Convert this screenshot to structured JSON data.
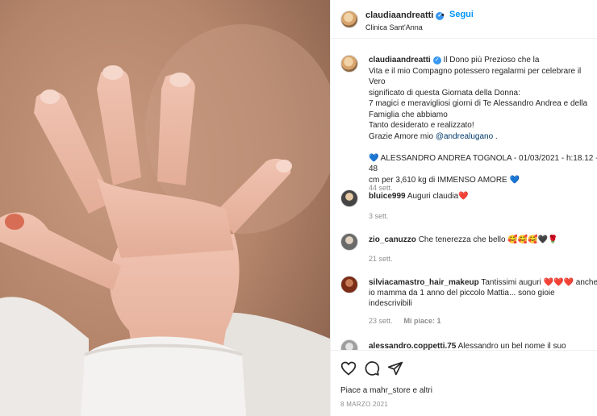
{
  "header": {
    "username": "claudiaandreatti",
    "verified_glyph": "✓",
    "separator": "•",
    "follow_label": "Segui",
    "location": "Clinica Sant'Anna"
  },
  "caption": {
    "username": "claudiaandreatti",
    "verified_glyph": "✓",
    "line1": "Il Dono più Prezioso che la",
    "line2": "Vita e il mio Compagno potessero regalarmi per celebrare il Vero",
    "line3": "significato di questa Giornata della Donna:",
    "line4": "7 magici e meravigliosi giorni di Te Alessandro Andrea e della",
    "line5": "Famiglia che abbiamo",
    "line6": "Tanto desiderato e realizzato!",
    "thanks": "Grazie Amore mio",
    "mention": "@andrealugano",
    "thanks_end": " .",
    "heart_icon": "💙",
    "birth_line1": " ALESSANDRO ANDREA TOGNOLA - 01/03/2021 - h:18.12 - 48",
    "birth_line2": "cm per 3,610 kg di IMMENSO AMORE ",
    "time": "44 sett."
  },
  "comments": [
    {
      "username": "bluice999",
      "text": "Auguri claudia",
      "emoji": "❤️",
      "time": "3 sett.",
      "reply_likes": ""
    },
    {
      "username": "zio_canuzzo",
      "text": "Che tenerezza che bello ",
      "emoji": "🥰🥰🥰🖤🌹",
      "time": "21 sett.",
      "reply_likes": ""
    },
    {
      "username": "silviacamastro_hair_makeup",
      "text": "Tantissimi auguri ",
      "emoji": "❤️❤️❤️",
      "text2": " anche io mamma da 1 anno del piccolo Mattia... sono gioie indescrivibili",
      "time": "23 sett.",
      "reply_likes": "Mi piace: 1"
    },
    {
      "username": "alessandro.coppetti.75",
      "text": "Alessandro un bel nome il suo",
      "emoji": "",
      "time": "",
      "reply_likes": ""
    }
  ],
  "actions": {
    "like_icon": "heart-icon",
    "comment_icon": "comment-icon",
    "share_icon": "share-icon",
    "save_icon": "bookmark-icon"
  },
  "likes_text": "Piace a mahr_store e altri",
  "date": "8 MARZO 2021",
  "colors": {
    "accent": "#0095f6",
    "verified": "#3897f0",
    "muted": "#8e8e8e",
    "heart_red": "#ed1c3a",
    "heart_blue": "#1c6fd1"
  }
}
